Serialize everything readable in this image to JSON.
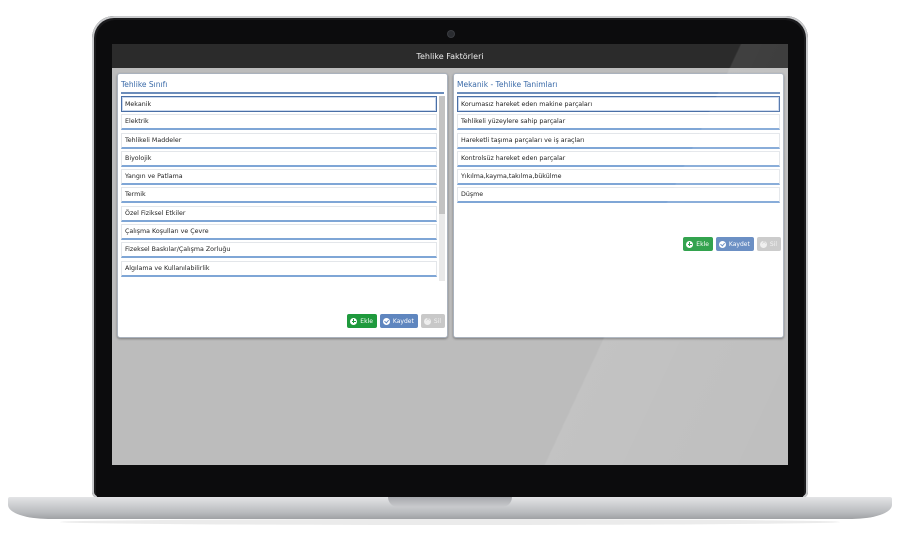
{
  "app": {
    "title": "Tehlike Faktörleri"
  },
  "left_panel": {
    "header": "Tehlike Sınıfı",
    "items": [
      "Mekanik",
      "Elektrik",
      "Tehlikeli Maddeler",
      "Biyolojik",
      "Yangın ve Patlama",
      "Termik",
      "Özel Fiziksel Etkiler",
      "Çalışma Koşulları ve Çevre",
      "Fizeksel Baskılar/Çalışma Zorluğu",
      "Algılama ve Kullanılabilirlik"
    ],
    "selected_index": 0,
    "buttons": {
      "add": "Ekle",
      "save": "Kaydet",
      "delete": "Sil"
    }
  },
  "right_panel": {
    "header": "Mekanik - Tehlike Tanimları",
    "items": [
      "Korumasız hareket eden makine parçaları",
      "Tehlikeli yüzeylere sahip parçalar",
      "Hareketli taşıma parçaları ve iş araçları",
      "Kontrolsüz hareket eden parçalar",
      "Yıkılma,kayma,takılma,bükülme",
      "Düşme"
    ],
    "selected_index": 0,
    "buttons": {
      "add": "Ekle",
      "save": "Kaydet",
      "delete": "Sil"
    }
  },
  "colors": {
    "title_bar": "#2b2b2b",
    "header_text": "#3a6aa8",
    "add_button": "#1f9a3d",
    "save_button": "#5f86bf",
    "delete_button_disabled": "#c8c8c8"
  }
}
